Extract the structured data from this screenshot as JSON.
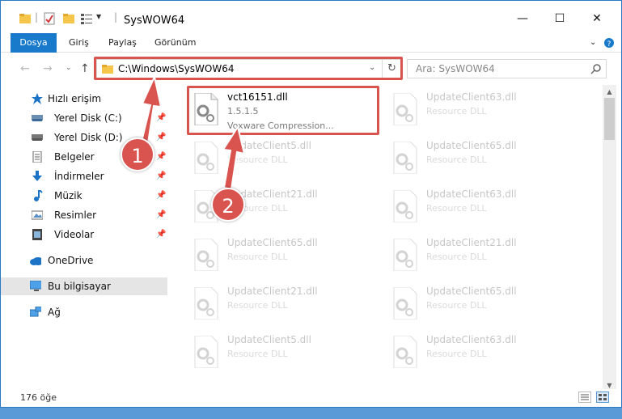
{
  "window": {
    "title": "SysWOW64",
    "minimize_glyph": "—",
    "maximize_glyph": "☐",
    "close_glyph": "✕"
  },
  "ribbon": {
    "tabs": [
      "Dosya",
      "Giriş",
      "Paylaş",
      "Görünüm"
    ],
    "accent_color": "#1979ca"
  },
  "nav": {
    "address": "C:\\Windows\\SysWOW64",
    "search_placeholder": "Ara: SysWOW64"
  },
  "sidebar": {
    "items": [
      {
        "label": "Hızlı erişim",
        "icon": "star-icon"
      },
      {
        "label": "Yerel Disk (C:)",
        "icon": "drive-icon",
        "pinned": true
      },
      {
        "label": "Yerel Disk (D:)",
        "icon": "drive-icon",
        "pinned": true
      },
      {
        "label": "Belgeler",
        "icon": "documents-icon",
        "pinned": true
      },
      {
        "label": "İndirmeler",
        "icon": "download-icon",
        "pinned": true
      },
      {
        "label": "Müzik",
        "icon": "music-icon",
        "pinned": true
      },
      {
        "label": "Resimler",
        "icon": "pictures-icon",
        "pinned": true
      },
      {
        "label": "Videolar",
        "icon": "videos-icon",
        "pinned": true
      },
      {
        "label": "OneDrive",
        "icon": "onedrive-icon"
      },
      {
        "label": "Bu bilgisayar",
        "icon": "computer-icon",
        "selected": true
      },
      {
        "label": "Ağ",
        "icon": "network-icon"
      }
    ]
  },
  "files": [
    {
      "name": "vct16151.dll",
      "version": "1.5.1.5",
      "description": "Voxware Compression..."
    },
    {
      "name": "UpdateClient63.dll",
      "description": "Resource DLL"
    },
    {
      "name": "UpdateClient5.dll",
      "description": "Resource DLL"
    },
    {
      "name": "UpdateClient65.dll",
      "description": "Resource DLL"
    },
    {
      "name": "UpdateClient21.dll",
      "description": "Resource DLL"
    },
    {
      "name": "UpdateClient63.dll",
      "description": "Resource DLL"
    },
    {
      "name": "UpdateClient65.dll",
      "description": "Resource DLL"
    },
    {
      "name": "UpdateClient21.dll",
      "description": "Resource DLL"
    },
    {
      "name": "UpdateClient21.dll",
      "description": "Resource DLL"
    },
    {
      "name": "UpdateClient65.dll",
      "description": "Resource DLL"
    },
    {
      "name": "UpdateClient5.dll",
      "description": "Resource DLL"
    },
    {
      "name": "UpdateClient63.dll",
      "description": "Resource DLL"
    }
  ],
  "status": {
    "item_count": "176 öğe"
  },
  "annotations": {
    "step1": "1",
    "step2": "2",
    "color": "#d9534f"
  }
}
